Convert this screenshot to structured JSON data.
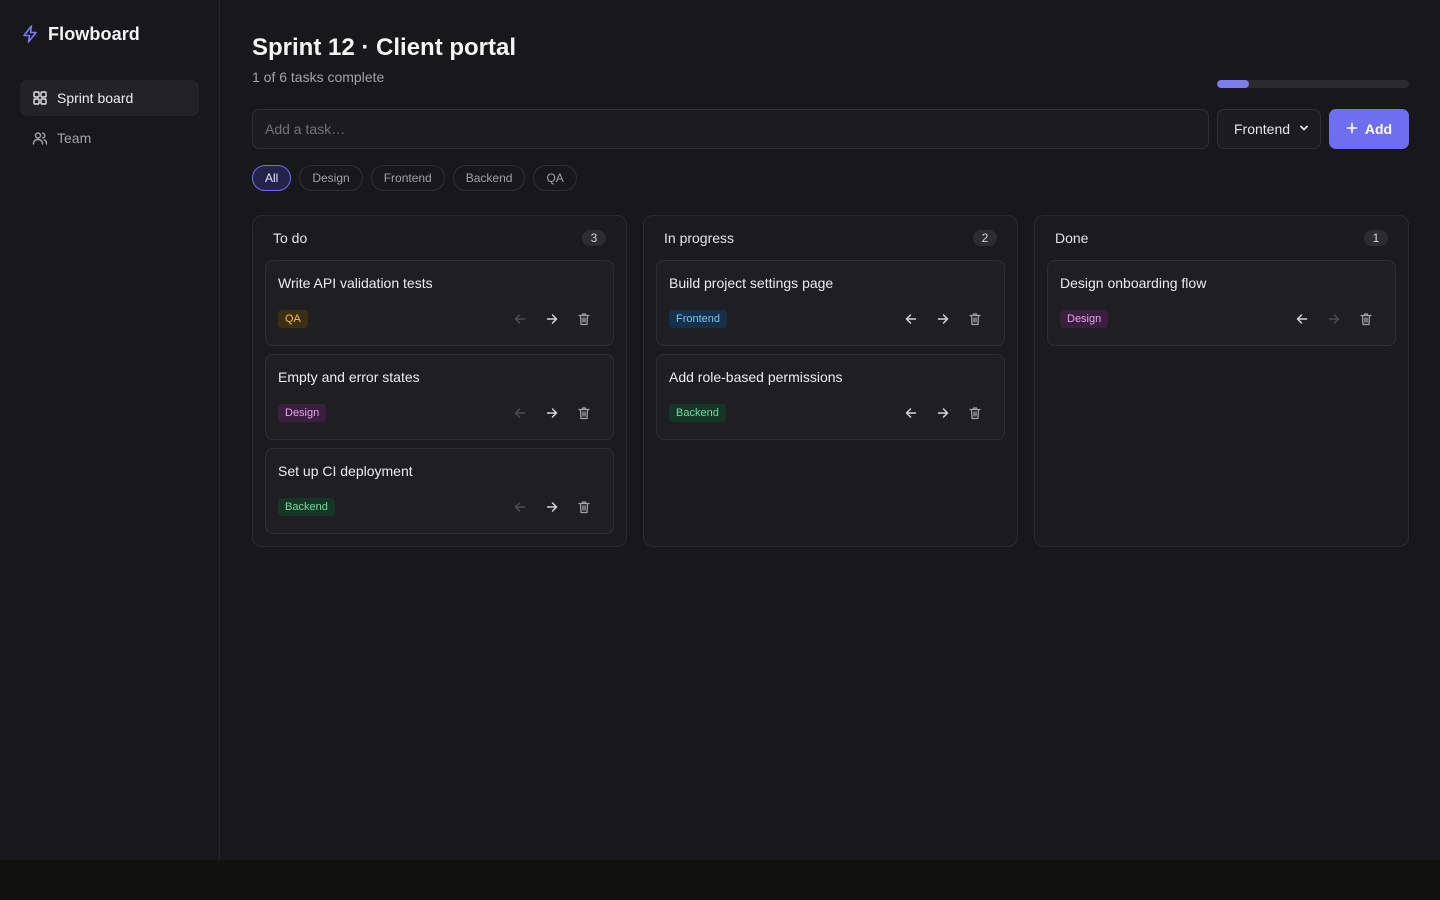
{
  "app": {
    "name": "Flowboard",
    "accent": "#6e6ef0"
  },
  "sidebar": {
    "items": [
      {
        "label": "Sprint board",
        "icon": "grid-icon",
        "active": true
      },
      {
        "label": "Team",
        "icon": "users-icon",
        "active": false
      }
    ]
  },
  "header": {
    "title": "Sprint 12 · Client portal",
    "subtitle": "1 of 6 tasks complete",
    "progress": 0.1667
  },
  "toolbar": {
    "input_placeholder": "Add a task…",
    "input_value": "",
    "select_value": "Frontend",
    "add_label": "Add"
  },
  "filters": [
    {
      "label": "All",
      "active": true
    },
    {
      "label": "Design",
      "active": false
    },
    {
      "label": "Frontend",
      "active": false
    },
    {
      "label": "Backend",
      "active": false
    },
    {
      "label": "QA",
      "active": false
    }
  ],
  "columns": [
    {
      "title": "To do",
      "count": "3",
      "cards": [
        {
          "title": "Write API validation tests",
          "tag": "QA",
          "tag_type": "qa",
          "can_left": false,
          "can_right": true
        },
        {
          "title": "Empty and error states",
          "tag": "Design",
          "tag_type": "design",
          "can_left": false,
          "can_right": true
        },
        {
          "title": "Set up CI deployment",
          "tag": "Backend",
          "tag_type": "backend",
          "can_left": false,
          "can_right": true
        }
      ]
    },
    {
      "title": "In progress",
      "count": "2",
      "cards": [
        {
          "title": "Build project settings page",
          "tag": "Frontend",
          "tag_type": "frontend",
          "can_left": true,
          "can_right": true
        },
        {
          "title": "Add role-based permissions",
          "tag": "Backend",
          "tag_type": "backend",
          "can_left": true,
          "can_right": true
        }
      ]
    },
    {
      "title": "Done",
      "count": "1",
      "cards": [
        {
          "title": "Design onboarding flow",
          "tag": "Design",
          "tag_type": "design",
          "can_left": true,
          "can_right": false
        }
      ]
    }
  ]
}
